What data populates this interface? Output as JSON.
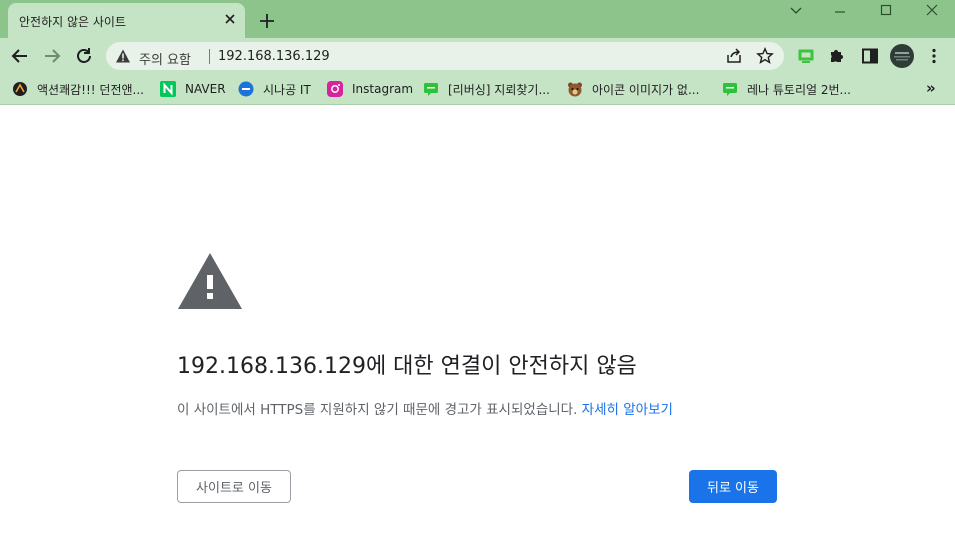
{
  "browser": {
    "tab": {
      "title": "안전하지 않은 사이트"
    },
    "omnibox": {
      "security_label": "주의 요함",
      "url": "192.168.136.129"
    },
    "bookmarks": [
      {
        "label": "액션쾌감!!! 던전앤...",
        "icon": "dungeon-icon"
      },
      {
        "label": "NAVER",
        "icon": "naver-icon"
      },
      {
        "label": "시나공 IT",
        "icon": "sinagong-icon"
      },
      {
        "label": "Instagram",
        "icon": "instagram-icon"
      },
      {
        "label": "[리버싱] 지뢰찾기...",
        "icon": "chat-icon"
      },
      {
        "label": "아이콘 이미지가 없...",
        "icon": "bear-icon"
      },
      {
        "label": "레나 튜토리얼 2번...",
        "icon": "chat-icon"
      }
    ],
    "bookmarks_overflow": "»"
  },
  "page": {
    "heading": "192.168.136.129에 대한 연결이 안전하지 않음",
    "description": "이 사이트에서 HTTPS를 지원하지 않기 때문에 경고가 표시되었습니다.",
    "learn_more": "자세히 알아보기",
    "continue_button": "사이트로 이동",
    "back_button": "뒤로 이동"
  },
  "colors": {
    "titlebar": "#8cc48c",
    "toolbar": "#c5e3c5",
    "primary": "#1a73e8",
    "link": "#1a73e8",
    "warning_icon": "#5f6368"
  }
}
